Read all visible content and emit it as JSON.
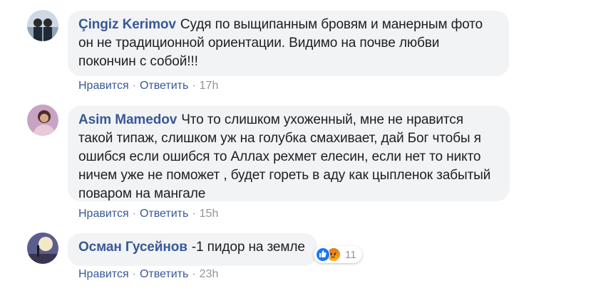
{
  "comments": [
    {
      "author": "Çingiz Kerimov",
      "text": "Судя по выщипанным бровям и манерным фото он не традиционной ориентации. Видимо на почве любви покончин с собой!!!",
      "like_label": "Нравится",
      "reply_label": "Ответить",
      "separator": "·",
      "time": "17h"
    },
    {
      "author": "Asim Mamedov",
      "text": "Что то слишком ухоженный, мне не нравится такой типаж, слишком уж на голубка смахивает, дай Бог чтобы я ошибся если ошибся то Аллах рехмет елесин, если нет то никто ничем уже не поможет , будет гореть в аду как цыпленок забытый поваром на мангале",
      "like_label": "Нравится",
      "reply_label": "Ответить",
      "separator": "·",
      "time": "15h"
    },
    {
      "author": "Осман Гусейнов",
      "text": "-1 пидор на земле",
      "like_label": "Нравится",
      "reply_label": "Ответить",
      "separator": "·",
      "time": "23h",
      "reactions": {
        "icons": [
          "like-icon",
          "angry-icon"
        ],
        "count": "11"
      }
    }
  ],
  "colors": {
    "author": "#385898",
    "bubble_bg": "#f2f3f5",
    "meta": "#90949c",
    "like_reaction": "#1877f2",
    "angry_reaction": "#e9710f"
  }
}
